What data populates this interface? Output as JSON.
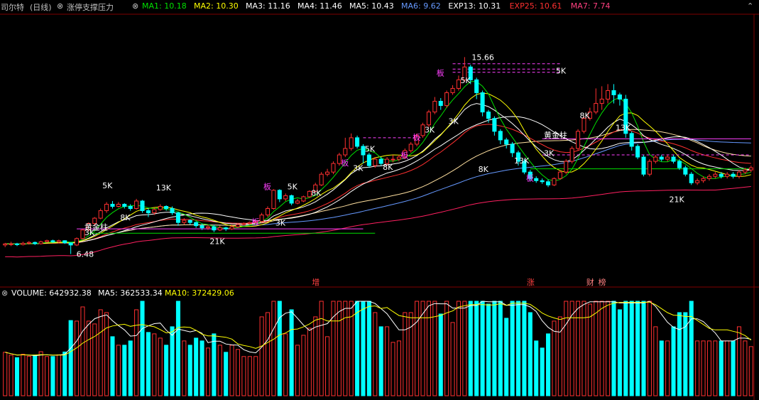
{
  "header": {
    "stock_name": "司尔特",
    "period": "(日线)",
    "indicator_name": "涨停支撑压力",
    "ma_values": [
      {
        "label": "MA1: 10.18",
        "color": "#00e000"
      },
      {
        "label": "MA2: 10.30",
        "color": "#ffff00"
      },
      {
        "label": "MA3: 11.16",
        "color": "#ffffff"
      },
      {
        "label": "MA4: 11.46",
        "color": "#ffffff"
      },
      {
        "label": "MA5: 10.43",
        "color": "#ffffff"
      },
      {
        "label": "MA6: 9.62",
        "color": "#6699ff"
      },
      {
        "label": "EXP13: 10.31",
        "color": "#ffffff"
      },
      {
        "label": "EXP25: 10.61",
        "color": "#ff3030"
      },
      {
        "label": "MA7: 7.74",
        "color": "#ff4080"
      }
    ]
  },
  "volume_header": {
    "label": "VOLUME: 642932.38",
    "ma5": "MA5: 362533.34",
    "ma10": "MA10: 372429.06"
  },
  "colors": {
    "up": "#ff3030",
    "down": "#00ffff",
    "ma1": "#00e000",
    "ma2": "#ffff00",
    "ma3": "#ffffff",
    "ma6": "#6699ff",
    "exp25": "#ff3030",
    "ma7": "#ff2060",
    "ma5": "#ffe0a0"
  },
  "chart_data": {
    "type": "candlestick",
    "high_label": "15.66",
    "low_label": "6.48",
    "price_ylim": [
      6.0,
      16.5
    ],
    "candles": [
      [
        6.9,
        6.95,
        6.8,
        7.0
      ],
      [
        6.95,
        6.95,
        6.85,
        7.05
      ],
      [
        6.95,
        6.92,
        6.85,
        7.0
      ],
      [
        6.92,
        6.98,
        6.88,
        7.05
      ],
      [
        6.98,
        7.02,
        6.92,
        7.08
      ],
      [
        7.02,
        6.96,
        6.9,
        7.06
      ],
      [
        6.96,
        7.05,
        6.92,
        7.1
      ],
      [
        7.05,
        7.1,
        7.0,
        7.15
      ],
      [
        7.1,
        7.05,
        7.0,
        7.15
      ],
      [
        7.05,
        7.1,
        6.98,
        7.15
      ],
      [
        7.1,
        7.0,
        6.95,
        7.12
      ],
      [
        7.0,
        6.9,
        6.48,
        7.02
      ],
      [
        6.9,
        7.2,
        6.85,
        7.25
      ],
      [
        7.2,
        7.6,
        7.15,
        7.65
      ],
      [
        7.6,
        7.9,
        7.55,
        7.95
      ],
      [
        7.9,
        8.15,
        7.8,
        8.2
      ],
      [
        8.15,
        8.5,
        8.1,
        8.6
      ],
      [
        8.5,
        8.8,
        8.4,
        8.9
      ],
      [
        8.8,
        8.7,
        8.6,
        8.95
      ],
      [
        8.7,
        8.8,
        8.65,
        8.9
      ],
      [
        8.8,
        8.7,
        8.6,
        8.85
      ],
      [
        8.7,
        8.6,
        8.5,
        8.8
      ],
      [
        8.6,
        8.95,
        8.55,
        9.05
      ],
      [
        8.95,
        8.5,
        8.4,
        9.0
      ],
      [
        8.5,
        8.4,
        8.2,
        8.6
      ],
      [
        8.4,
        8.55,
        8.3,
        8.65
      ],
      [
        8.55,
        8.7,
        8.5,
        8.8
      ],
      [
        8.7,
        8.6,
        8.5,
        8.75
      ],
      [
        8.6,
        8.4,
        8.3,
        8.7
      ],
      [
        8.4,
        7.95,
        7.8,
        8.45
      ],
      [
        7.95,
        8.05,
        7.85,
        8.15
      ],
      [
        8.05,
        7.95,
        7.85,
        8.1
      ],
      [
        7.95,
        7.8,
        7.7,
        8.0
      ],
      [
        7.8,
        7.7,
        7.6,
        7.9
      ],
      [
        7.7,
        7.75,
        7.6,
        7.85
      ],
      [
        7.75,
        7.6,
        7.5,
        7.85
      ],
      [
        7.6,
        7.7,
        7.55,
        7.8
      ],
      [
        7.7,
        7.65,
        7.55,
        7.75
      ],
      [
        7.65,
        7.75,
        7.6,
        7.85
      ],
      [
        7.75,
        7.85,
        7.7,
        7.9
      ],
      [
        7.85,
        7.9,
        7.8,
        7.95
      ],
      [
        7.9,
        7.95,
        7.85,
        8.0
      ],
      [
        7.95,
        8.0,
        7.9,
        8.05
      ],
      [
        8.0,
        8.3,
        7.95,
        8.4
      ],
      [
        8.3,
        8.6,
        8.2,
        8.7
      ],
      [
        8.6,
        9.45,
        8.55,
        9.5
      ],
      [
        9.45,
        9.05,
        8.9,
        9.5
      ],
      [
        9.05,
        9.2,
        8.95,
        9.3
      ],
      [
        9.2,
        8.85,
        8.75,
        9.25
      ],
      [
        8.85,
        8.95,
        8.8,
        9.05
      ],
      [
        8.95,
        9.15,
        8.9,
        9.2
      ],
      [
        9.15,
        9.4,
        9.1,
        9.45
      ],
      [
        9.4,
        9.7,
        9.35,
        9.8
      ],
      [
        9.7,
        10.2,
        9.65,
        10.3
      ],
      [
        10.2,
        10.3,
        10.1,
        10.45
      ],
      [
        10.3,
        10.7,
        10.2,
        10.8
      ],
      [
        10.7,
        11.1,
        10.6,
        11.2
      ],
      [
        11.1,
        11.4,
        11.0,
        11.9
      ],
      [
        11.4,
        11.9,
        11.3,
        12.1
      ],
      [
        11.9,
        11.5,
        11.4,
        12.0
      ],
      [
        11.5,
        11.1,
        10.7,
        11.6
      ],
      [
        11.1,
        10.6,
        10.5,
        11.2
      ],
      [
        10.6,
        10.9,
        10.5,
        11.0
      ],
      [
        10.9,
        10.7,
        10.6,
        11.0
      ],
      [
        10.7,
        10.9,
        10.6,
        11.0
      ],
      [
        10.9,
        10.9,
        10.75,
        11.1
      ],
      [
        10.9,
        11.0,
        10.8,
        11.1
      ],
      [
        11.0,
        11.3,
        10.9,
        11.4
      ],
      [
        11.3,
        11.6,
        11.2,
        11.7
      ],
      [
        11.6,
        12.0,
        11.5,
        12.1
      ],
      [
        12.0,
        12.5,
        11.9,
        12.6
      ],
      [
        12.5,
        13.1,
        12.4,
        13.2
      ],
      [
        13.1,
        13.6,
        13.0,
        13.8
      ],
      [
        13.6,
        13.4,
        13.2,
        13.75
      ],
      [
        13.4,
        14.0,
        13.3,
        14.1
      ],
      [
        14.0,
        14.2,
        13.9,
        14.35
      ],
      [
        14.2,
        14.6,
        14.1,
        14.8
      ],
      [
        14.6,
        15.2,
        14.5,
        15.66
      ],
      [
        15.2,
        14.6,
        14.4,
        15.3
      ],
      [
        14.6,
        14.0,
        13.7,
        14.7
      ],
      [
        14.0,
        13.1,
        12.9,
        14.1
      ],
      [
        13.1,
        12.8,
        12.6,
        13.2
      ],
      [
        12.8,
        12.2,
        12.0,
        12.9
      ],
      [
        12.2,
        11.8,
        11.6,
        12.3
      ],
      [
        11.8,
        11.6,
        11.4,
        11.9
      ],
      [
        11.6,
        11.2,
        11.0,
        11.7
      ],
      [
        11.2,
        10.8,
        10.6,
        11.3
      ],
      [
        10.8,
        10.3,
        10.2,
        10.9
      ],
      [
        10.3,
        10.0,
        9.9,
        10.4
      ],
      [
        10.0,
        9.9,
        9.8,
        10.1
      ],
      [
        9.9,
        9.85,
        9.75,
        10.0
      ],
      [
        9.85,
        9.7,
        9.6,
        9.95
      ],
      [
        9.7,
        10.0,
        9.65,
        10.05
      ],
      [
        10.0,
        10.3,
        9.95,
        10.4
      ],
      [
        10.3,
        10.8,
        10.2,
        10.9
      ],
      [
        10.8,
        11.4,
        10.7,
        11.5
      ],
      [
        11.4,
        12.2,
        11.3,
        12.3
      ],
      [
        12.2,
        12.8,
        12.1,
        12.9
      ],
      [
        12.8,
        13.1,
        12.7,
        13.3
      ],
      [
        13.1,
        13.5,
        13.0,
        14.2
      ],
      [
        13.5,
        13.7,
        13.2,
        14.3
      ],
      [
        13.7,
        14.1,
        13.5,
        14.4
      ],
      [
        14.1,
        13.9,
        13.5,
        14.4
      ],
      [
        13.9,
        13.7,
        13.4,
        14.0
      ],
      [
        13.7,
        12.1,
        11.9,
        13.9
      ],
      [
        12.1,
        11.5,
        11.3,
        12.2
      ],
      [
        11.5,
        11.0,
        10.9,
        11.6
      ],
      [
        11.0,
        10.2,
        10.1,
        11.1
      ],
      [
        10.2,
        10.8,
        10.1,
        10.9
      ],
      [
        10.8,
        11.0,
        10.7,
        11.1
      ],
      [
        11.0,
        10.9,
        10.8,
        11.1
      ],
      [
        10.9,
        11.0,
        10.8,
        11.1
      ],
      [
        11.0,
        10.8,
        10.7,
        11.1
      ],
      [
        10.8,
        10.5,
        10.4,
        10.9
      ],
      [
        10.5,
        10.2,
        10.1,
        10.6
      ],
      [
        10.2,
        9.8,
        9.7,
        10.3
      ],
      [
        9.8,
        9.9,
        9.7,
        10.0
      ],
      [
        9.9,
        10.0,
        9.8,
        10.1
      ],
      [
        10.0,
        10.1,
        9.9,
        10.2
      ],
      [
        10.1,
        10.2,
        10.0,
        10.3
      ],
      [
        10.2,
        10.1,
        10.0,
        10.3
      ],
      [
        10.1,
        10.2,
        10.0,
        10.3
      ],
      [
        10.2,
        10.1,
        10.0,
        10.3
      ],
      [
        10.1,
        10.3,
        10.0,
        10.4
      ],
      [
        10.3,
        10.4,
        10.2,
        10.5
      ],
      [
        10.4,
        10.5,
        10.3,
        10.6
      ]
    ],
    "volumes": [],
    "labels": [
      {
        "text": "5K",
        "i": 17,
        "price": 9.55,
        "color": "#ffffff"
      },
      {
        "text": "3K",
        "i": 14,
        "price": 7.35,
        "color": "#ffffff"
      },
      {
        "text": "8K",
        "i": 20,
        "price": 8.05,
        "color": "#ffffff"
      },
      {
        "text": "13K",
        "i": 26,
        "price": 9.45,
        "color": "#ffffff"
      },
      {
        "text": "21K",
        "i": 35,
        "price": 6.95,
        "color": "#ffffff"
      },
      {
        "text": "黄金柱",
        "i": 14,
        "price": 7.6,
        "color": "#ffffff"
      },
      {
        "text": "板",
        "i": 42,
        "price": 7.85,
        "color": "#ff40ff"
      },
      {
        "text": "板",
        "i": 44,
        "price": 9.5,
        "color": "#ff40ff"
      },
      {
        "text": "5K",
        "i": 48,
        "price": 9.5,
        "color": "#ffffff"
      },
      {
        "text": "8K",
        "i": 52,
        "price": 9.2,
        "color": "#ffffff"
      },
      {
        "text": "3K",
        "i": 46,
        "price": 7.8,
        "color": "#ffffff"
      },
      {
        "text": "3K",
        "i": 59,
        "price": 10.35,
        "color": "#ffffff"
      },
      {
        "text": "5K",
        "i": 61,
        "price": 11.25,
        "color": "#ffffff"
      },
      {
        "text": "板",
        "i": 57,
        "price": 10.6,
        "color": "#ff40ff"
      },
      {
        "text": "8K",
        "i": 64,
        "price": 10.4,
        "color": "#ffffff"
      },
      {
        "text": "板",
        "i": 67,
        "price": 10.95,
        "color": "#ff40ff"
      },
      {
        "text": "板",
        "i": 69,
        "price": 11.8,
        "color": "#ff40ff"
      },
      {
        "text": "3K",
        "i": 71,
        "price": 12.15,
        "color": "#ffffff"
      },
      {
        "text": "板",
        "i": 73,
        "price": 14.8,
        "color": "#ff40ff"
      },
      {
        "text": "3K",
        "i": 75,
        "price": 12.55,
        "color": "#ffffff"
      },
      {
        "text": "5K",
        "i": 77,
        "price": 14.45,
        "color": "#ffffff"
      },
      {
        "text": "8K",
        "i": 80,
        "price": 10.3,
        "color": "#ffffff"
      },
      {
        "text": "板",
        "i": 88,
        "price": 9.9,
        "color": "#ff40ff"
      },
      {
        "text": "13K",
        "i": 86,
        "price": 10.7,
        "color": "#ffffff"
      },
      {
        "text": "黄金柱",
        "i": 91,
        "price": 11.9,
        "color": "#ffffff"
      },
      {
        "text": "3K",
        "i": 91,
        "price": 11.05,
        "color": "#ffffff"
      },
      {
        "text": "5K",
        "i": 93,
        "price": 14.9,
        "color": "#ffffff"
      },
      {
        "text": "8K",
        "i": 97,
        "price": 12.8,
        "color": "#ffffff"
      },
      {
        "text": "13K",
        "i": 103,
        "price": 12.25,
        "color": "#ffffff"
      },
      {
        "text": "21K",
        "i": 112,
        "price": 8.9,
        "color": "#ffffff"
      }
    ],
    "markers": [
      {
        "text": "增",
        "i": 52,
        "color": "#ff4040"
      },
      {
        "text": "涨",
        "i": 88,
        "color": "#ff4040"
      },
      {
        "text": "财",
        "i": 98,
        "color": "#ff8080"
      },
      {
        "text": "榜",
        "i": 100,
        "color": "#ff8080"
      }
    ]
  }
}
